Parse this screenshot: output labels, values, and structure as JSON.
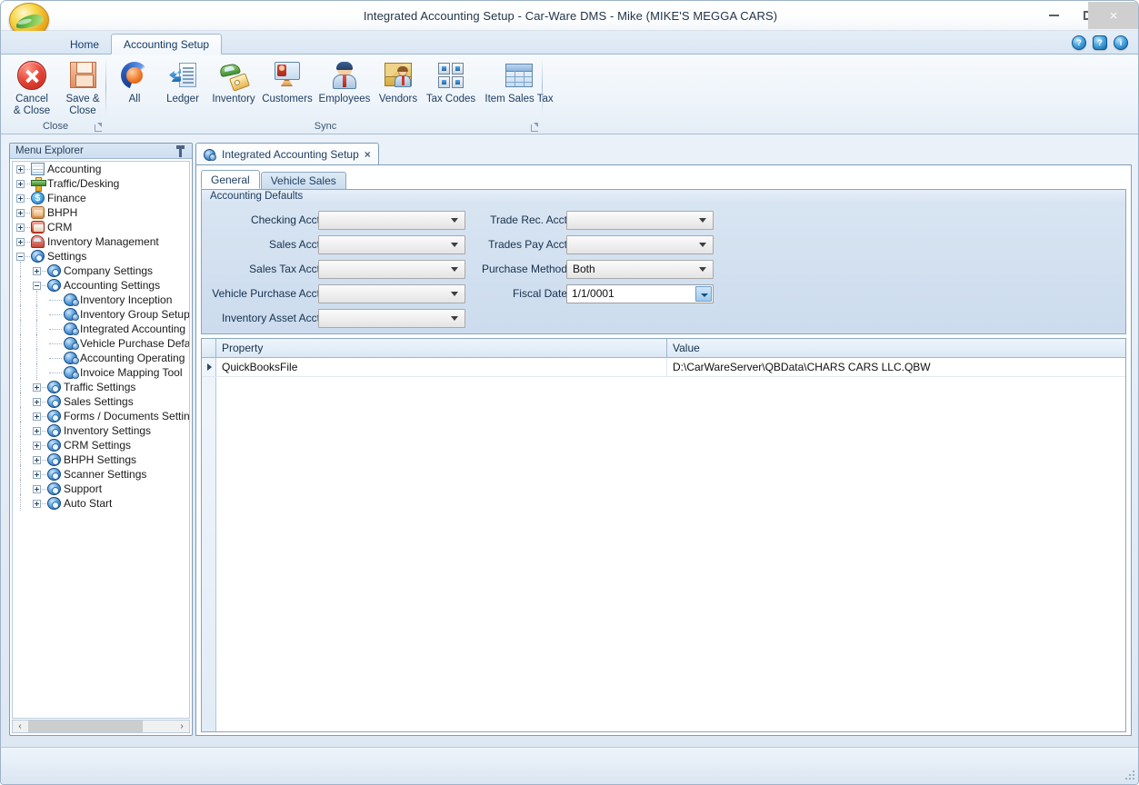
{
  "window": {
    "title": "Integrated Accounting Setup - Car-Ware DMS - Mike (MIKE'S MEGGA CARS)",
    "minimize_label": "Minimize",
    "maximize_label": "Maximize",
    "close_label": "×"
  },
  "ribbon": {
    "tabs": [
      {
        "label": "Home",
        "active": false
      },
      {
        "label": "Accounting Setup",
        "active": true
      }
    ],
    "help_icons": [
      "help-circle-icon",
      "help-speech-icon",
      "info-circle-icon"
    ],
    "groups": [
      {
        "caption": "Close",
        "buttons": [
          {
            "label": "Cancel\n& Close",
            "line1": "Cancel",
            "line2": "& Close",
            "icon": "cancel-icon"
          },
          {
            "label": "Save &\nClose",
            "line1": "Save &",
            "line2": "Close",
            "icon": "save-icon"
          }
        ]
      },
      {
        "caption": "Sync",
        "buttons": [
          {
            "label": "All",
            "icon": "sync-all-icon"
          },
          {
            "label": "Ledger",
            "icon": "ledger-icon"
          },
          {
            "label": "Inventory",
            "icon": "inventory-icon"
          },
          {
            "label": "Customers",
            "icon": "customers-icon"
          },
          {
            "label": "Employees",
            "icon": "employees-icon"
          },
          {
            "label": "Vendors",
            "icon": "vendors-icon"
          },
          {
            "label": "Tax Codes",
            "icon": "tax-codes-icon"
          },
          {
            "label": "Item Sales Tax",
            "icon": "item-sales-tax-icon"
          }
        ]
      }
    ]
  },
  "explorer": {
    "title": "Menu Explorer",
    "pin_icon": "pin-icon",
    "nodes": [
      {
        "label": "Accounting",
        "depth": 0,
        "state": "collapsed",
        "icon": "ti-grid"
      },
      {
        "label": "Traffic/Desking",
        "depth": 0,
        "state": "collapsed",
        "icon": "ti-cross"
      },
      {
        "label": "Finance",
        "depth": 0,
        "state": "collapsed",
        "icon": "ti-dollar"
      },
      {
        "label": "BHPH",
        "depth": 0,
        "state": "collapsed",
        "icon": "ti-bhph"
      },
      {
        "label": "CRM",
        "depth": 0,
        "state": "collapsed",
        "icon": "ti-crm"
      },
      {
        "label": "Inventory Management",
        "depth": 0,
        "state": "collapsed",
        "icon": "ti-invmgmt"
      },
      {
        "label": "Settings",
        "depth": 0,
        "state": "expanded",
        "icon": "ti-gear"
      },
      {
        "label": "Company Settings",
        "depth": 1,
        "state": "collapsed",
        "icon": "ti-gear"
      },
      {
        "label": "Accounting Settings",
        "depth": 1,
        "state": "expanded",
        "icon": "ti-gear"
      },
      {
        "label": "Inventory Inception",
        "depth": 2,
        "state": "leaf",
        "icon": "ti-gear-sm"
      },
      {
        "label": "Inventory Group Setup",
        "depth": 2,
        "state": "leaf",
        "icon": "ti-gear-sm"
      },
      {
        "label": "Integrated Accounting",
        "depth": 2,
        "state": "leaf",
        "icon": "ti-gear-sm"
      },
      {
        "label": "Vehicle Purchase Defa",
        "depth": 2,
        "state": "leaf",
        "icon": "ti-gear-sm"
      },
      {
        "label": "Accounting Operating",
        "depth": 2,
        "state": "leaf",
        "icon": "ti-gear-sm"
      },
      {
        "label": "Invoice Mapping Tool",
        "depth": 2,
        "state": "leaf",
        "icon": "ti-gear-sm"
      },
      {
        "label": "Traffic Settings",
        "depth": 1,
        "state": "collapsed",
        "icon": "ti-gear"
      },
      {
        "label": "Sales Settings",
        "depth": 1,
        "state": "collapsed",
        "icon": "ti-gear"
      },
      {
        "label": "Forms / Documents Setting",
        "depth": 1,
        "state": "collapsed",
        "icon": "ti-gear"
      },
      {
        "label": "Inventory Settings",
        "depth": 1,
        "state": "collapsed",
        "icon": "ti-gear"
      },
      {
        "label": "CRM Settings",
        "depth": 1,
        "state": "collapsed",
        "icon": "ti-gear"
      },
      {
        "label": "BHPH Settings",
        "depth": 1,
        "state": "collapsed",
        "icon": "ti-gear"
      },
      {
        "label": "Scanner Settings",
        "depth": 1,
        "state": "collapsed",
        "icon": "ti-gear"
      },
      {
        "label": "Support",
        "depth": 1,
        "state": "collapsed",
        "icon": "ti-gear"
      },
      {
        "label": "Auto Start",
        "depth": 1,
        "state": "collapsed",
        "icon": "ti-gear"
      }
    ],
    "hscroll": {
      "left_arrow": "‹",
      "right_arrow": "›"
    }
  },
  "document": {
    "tab_label": "Integrated Accounting Setup",
    "tab_icon": "gear-pair-icon",
    "tab_close": "×",
    "inner_tabs": [
      {
        "label": "General",
        "active": true
      },
      {
        "label": "Vehicle Sales",
        "active": false
      }
    ]
  },
  "defaults": {
    "caption": "Accounting Defaults",
    "left_fields": [
      {
        "label": "Checking Acct",
        "value": "",
        "type": "combo"
      },
      {
        "label": "Sales Acct",
        "value": "",
        "type": "combo"
      },
      {
        "label": "Sales Tax Acct",
        "value": "",
        "type": "combo"
      },
      {
        "label": "Vehicle Purchase Acct",
        "value": "",
        "type": "combo"
      },
      {
        "label": "Inventory Asset Acct",
        "value": "",
        "type": "combo"
      }
    ],
    "right_fields": [
      {
        "label": "Trade Rec. Acct",
        "value": "",
        "type": "combo"
      },
      {
        "label": "Trades Pay Acct",
        "value": "",
        "type": "combo"
      },
      {
        "label": "Purchase Method",
        "value": "Both",
        "type": "combo"
      },
      {
        "label": "Fiscal Date",
        "value": "1/1/0001",
        "type": "date"
      }
    ]
  },
  "grid": {
    "columns": [
      "Property",
      "Value"
    ],
    "rows": [
      {
        "property": "QuickBooksFile",
        "value": "D:\\CarWareServer\\QBData\\CHARS CARS LLC.QBW",
        "selected": true
      }
    ]
  },
  "colors": {
    "accent": "#1d5fa4",
    "panel": "#d9e5f2",
    "frame": "#7f9cbb",
    "cancel_red": "#e8483a",
    "save_orange": "#e08f63"
  }
}
